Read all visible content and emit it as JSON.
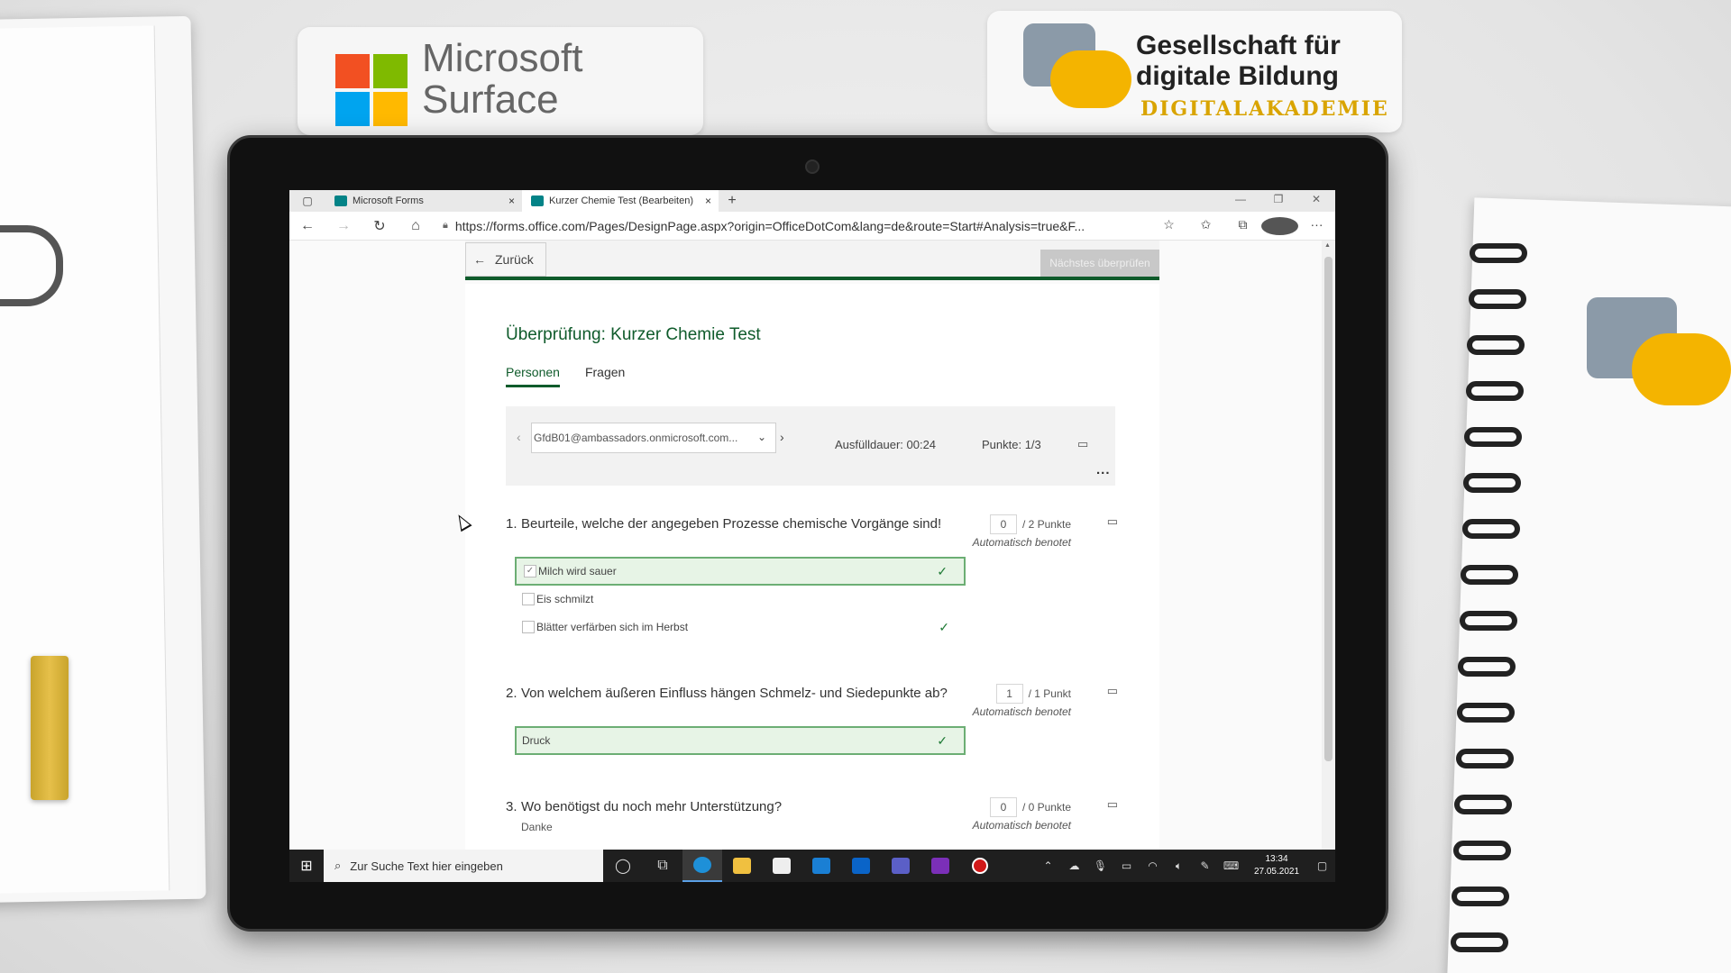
{
  "stickers": {
    "microsoft_line1": "Microsoft",
    "microsoft_line2": "Surface",
    "gfdb_line1": "Gesellschaft für",
    "gfdb_line2": "digitale Bildung",
    "gfdb_line3": "DIGITALAKADEMIE"
  },
  "browser": {
    "tabs": [
      {
        "label": "Microsoft Forms",
        "close": "×"
      },
      {
        "label": "Kurzer Chemie Test (Bearbeiten)",
        "close": "×"
      }
    ],
    "new_tab": "+",
    "url": "https://forms.office.com/Pages/DesignPage.aspx?origin=OfficeDotCom&lang=de&route=Start#Analysis=true&F...",
    "colors": {
      "accent": "#0f5b2b",
      "correct_bg": "#e7f4e6",
      "correct_border": "#6cae74"
    }
  },
  "form": {
    "back_label": "Zurück",
    "next_review_label": "Nächstes überprüfen",
    "title": "Überprüfung: Kurzer Chemie Test",
    "tabs": [
      "Personen",
      "Fragen"
    ],
    "respondent": "GfdB01@ambassadors.onmicrosoft.com...",
    "duration": "Ausfülldauer: 00:24",
    "points": "Punkte: 1/3",
    "more": "...",
    "questions": [
      {
        "number": "1.",
        "text": "Beurteile, welche der angegeben Prozesse chemische Vorgänge sind!",
        "score": "0",
        "max": "/ 2 Punkte",
        "auto": "Automatisch benotet",
        "options": [
          {
            "label": "Milch wird sauer",
            "checked": true,
            "correct": true
          },
          {
            "label": "Eis schmilzt",
            "checked": false,
            "correct": false
          },
          {
            "label": "Blätter verfärben sich im Herbst",
            "checked": false,
            "correct": true
          }
        ]
      },
      {
        "number": "2.",
        "text": "Von welchem äußeren Einfluss hängen Schmelz- und Siedepunkte ab?",
        "score": "1",
        "max": "/ 1 Punkt",
        "auto": "Automatisch benotet",
        "answer": "Druck"
      },
      {
        "number": "3.",
        "text": "Wo benötigst du noch mehr Unterstützung?",
        "score": "0",
        "max": "/ 0 Punkte",
        "auto": "Automatisch benotet",
        "answer": "Danke"
      }
    ]
  },
  "taskbar": {
    "search_placeholder": "Zur Suche Text hier eingeben",
    "time": "13:34",
    "date": "27.05.2021"
  }
}
